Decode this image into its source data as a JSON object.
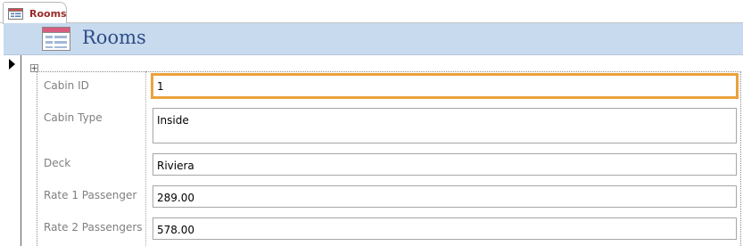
{
  "document_tab": {
    "label": "Rooms",
    "icon": "form-icon"
  },
  "form_header": {
    "title": "Rooms",
    "icon": "form-icon",
    "background_color": "#c8daee",
    "title_color": "#2d4d86"
  },
  "record_selector": {
    "icon": "current-record-pointer-icon"
  },
  "fields": [
    {
      "label": "Cabin ID",
      "value": "1"
    },
    {
      "label": "Cabin Type",
      "value": "Inside"
    },
    {
      "label": "Deck",
      "value": "Riviera"
    },
    {
      "label": "Rate 1 Passenger",
      "value": "289.00"
    },
    {
      "label": "Rate 2 Passengers",
      "value": "578.00"
    }
  ],
  "colors": {
    "focus_border": "#eba23b",
    "label_text": "#7f7f7f",
    "tab_label": "#9a2a2a"
  }
}
